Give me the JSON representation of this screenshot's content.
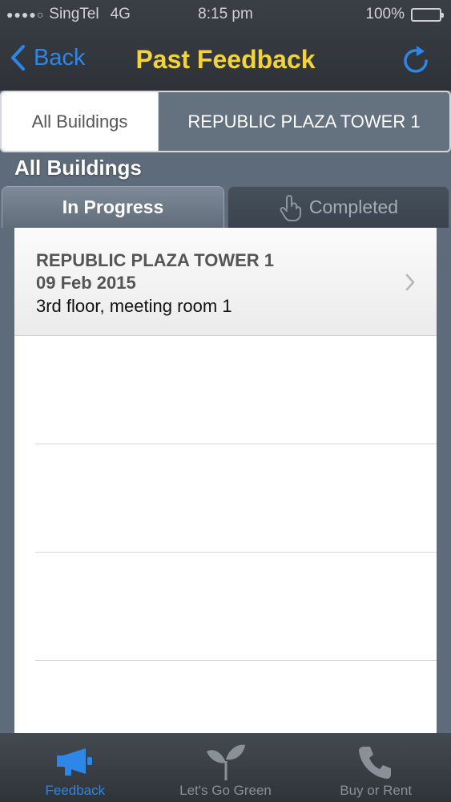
{
  "status_bar": {
    "signal_dots": "●●●●○",
    "carrier": "SingTel",
    "network": "4G",
    "time": "8:15 pm",
    "battery": "100%",
    "battery_level": 1.0
  },
  "nav": {
    "back_label": "Back",
    "title": "Past Feedback",
    "refresh_icon": "refresh-icon"
  },
  "segmented": {
    "all_label": "All Buildings",
    "building_label": "REPUBLIC PLAZA TOWER 1",
    "selected": "All Buildings"
  },
  "section_title": "All Buildings",
  "tabs": {
    "in_progress": "In Progress",
    "completed": "Completed",
    "selected": "In Progress"
  },
  "feedback_items": [
    {
      "building": "REPUBLIC PLAZA TOWER 1",
      "date": "09 Feb 2015",
      "location": "3rd floor, meeting room 1"
    }
  ],
  "tabbar": {
    "items": [
      {
        "label": "Feedback",
        "icon": "megaphone-icon",
        "active": true
      },
      {
        "label": "Let's Go Green",
        "icon": "sprout-icon",
        "active": false
      },
      {
        "label": "Buy or Rent",
        "icon": "phone-icon",
        "active": false
      }
    ]
  },
  "colors": {
    "accent_blue": "#2e86e6",
    "title_yellow": "#f4d33a",
    "background": "#5d6b7a"
  }
}
